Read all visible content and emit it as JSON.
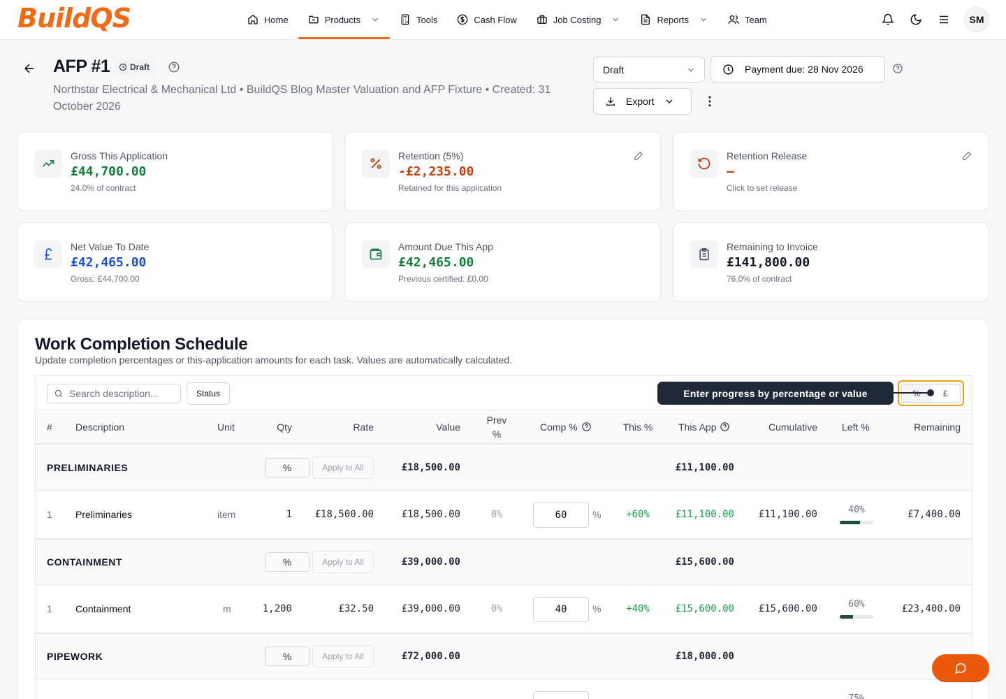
{
  "brand": {
    "logo": "BuildQS",
    "accent": "#f26a13"
  },
  "nav": {
    "items": [
      {
        "label": "Home",
        "icon": "home-icon",
        "dropdown": false,
        "active": false
      },
      {
        "label": "Products",
        "icon": "folder-icon",
        "dropdown": true,
        "active": true
      },
      {
        "label": "Tools",
        "icon": "calculator-icon",
        "dropdown": false,
        "active": false
      },
      {
        "label": "Cash Flow",
        "icon": "dollar-circle-icon",
        "dropdown": false,
        "active": false
      },
      {
        "label": "Job Costing",
        "icon": "briefcase-icon",
        "dropdown": true,
        "active": false
      },
      {
        "label": "Reports",
        "icon": "file-text-icon",
        "dropdown": true,
        "active": false
      },
      {
        "label": "Team",
        "icon": "users-icon",
        "dropdown": false,
        "active": false
      }
    ],
    "avatar": "SM"
  },
  "header": {
    "title": "AFP #1",
    "badge": "Draft",
    "subtitle": "Northstar Electrical & Mechanical Ltd • BuildQS Blog Master Valuation and AFP Fixture • Created: 31 October 2026",
    "status_select": "Draft",
    "payment_due": "Payment due: 28 Nov 2026",
    "export_label": "Export"
  },
  "cards": [
    {
      "label": "Gross This Application",
      "value": "£44,700.00",
      "sub": "24.0% of contract",
      "icon": "trending-up-icon",
      "color": "#15803d",
      "editable": false
    },
    {
      "label": "Retention (5%)",
      "value": "-£2,235.00",
      "sub": "Retained for this application",
      "icon": "percent-icon",
      "color": "#c2410c",
      "editable": true
    },
    {
      "label": "Retention Release",
      "value": "—",
      "sub": "Click to set release",
      "icon": "rotate-ccw-icon",
      "color": "#c2410c",
      "editable": true
    },
    {
      "label": "Net Value To Date",
      "value": "£42,465.00",
      "sub": "Gross: £44,700.00",
      "icon": "pound-icon",
      "color": "#1d4ed8",
      "editable": false
    },
    {
      "label": "Amount Due This App",
      "value": "£42,465.00",
      "sub": "Previous certified: £0.00",
      "icon": "wallet-icon",
      "color": "#15803d",
      "editable": false
    },
    {
      "label": "Remaining to Invoice",
      "value": "£141,800.00",
      "sub": "76.0% of contract",
      "icon": "clipboard-icon",
      "color": "#111827",
      "editable": false
    }
  ],
  "schedule": {
    "title": "Work Completion Schedule",
    "description": "Update completion percentages or this-application amounts for each task. Values are automatically calculated.",
    "search_placeholder": "Search description...",
    "status_button": "Status",
    "tooltip": "Enter progress by percentage or value",
    "toggle": {
      "pct": "%",
      "gbp": "£"
    },
    "columns": {
      "num": "#",
      "desc": "Description",
      "unit": "Unit",
      "qty": "Qty",
      "rate": "Rate",
      "value": "Value",
      "prev": "Prev %",
      "comp": "Comp %",
      "this_pct": "This %",
      "this_app": "This App",
      "cumulative": "Cumulative",
      "left": "Left %",
      "remaining": "Remaining"
    },
    "pct_symbol": "%",
    "apply_label": "Apply to All",
    "groups": [
      {
        "name": "PRELIMINARIES",
        "value": "£18,500.00",
        "this_app": "£11,100.00",
        "item": {
          "num": "1",
          "desc": "Preliminaries",
          "unit": "item",
          "qty": "1",
          "rate": "£18,500.00",
          "value": "£18,500.00",
          "prev": "0%",
          "comp": "60",
          "this_pct": "+60%",
          "this_app": "£11,100.00",
          "cumulative": "£11,100.00",
          "left": "40%",
          "left_fill": 0.6,
          "remaining": "£7,400.00"
        }
      },
      {
        "name": "CONTAINMENT",
        "value": "£39,000.00",
        "this_app": "£15,600.00",
        "item": {
          "num": "1",
          "desc": "Containment",
          "unit": "m",
          "qty": "1,200",
          "rate": "£32.50",
          "value": "£39,000.00",
          "prev": "0%",
          "comp": "40",
          "this_pct": "+40%",
          "this_app": "£15,600.00",
          "cumulative": "£15,600.00",
          "left": "60%",
          "left_fill": 0.4,
          "remaining": "£23,400.00"
        }
      },
      {
        "name": "PIPEWORK",
        "value": "£72,000.00",
        "this_app": "£18,000.00",
        "item": {
          "left": "75%"
        }
      }
    ]
  }
}
